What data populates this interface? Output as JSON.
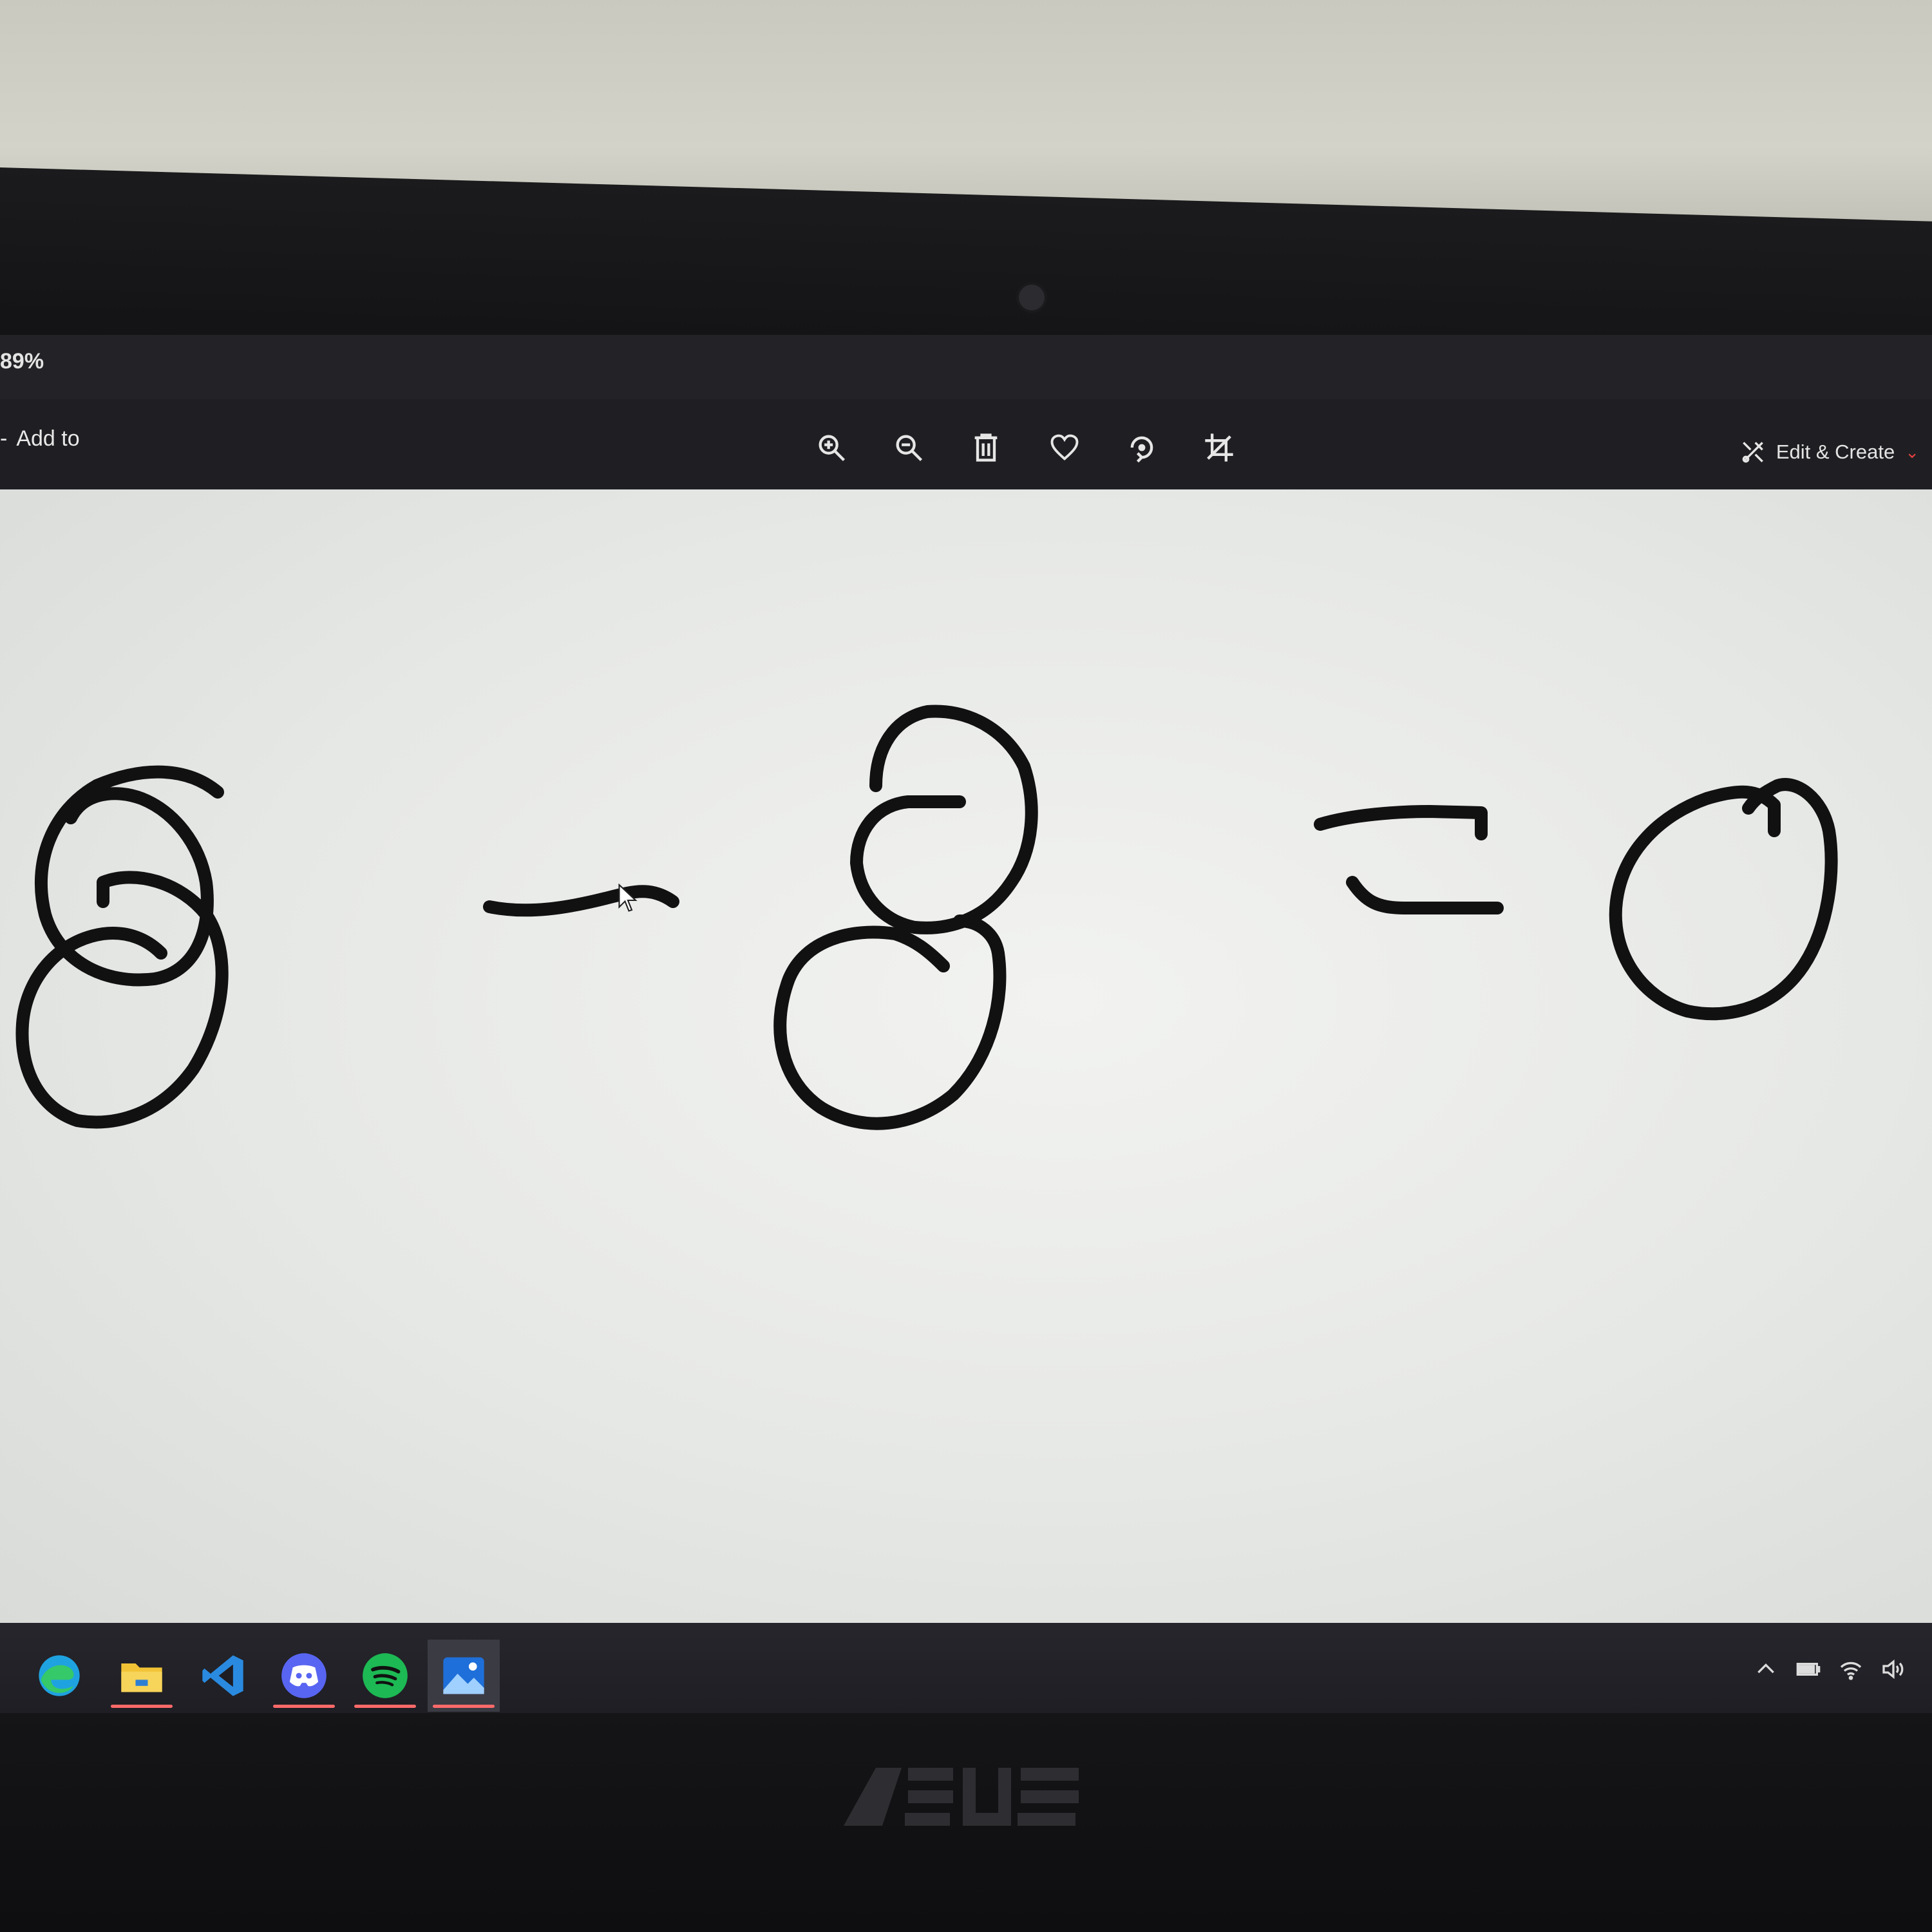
{
  "window": {
    "zoom_text": "89%"
  },
  "toolbar": {
    "add_to_label": "Add to",
    "tools": [
      {
        "name": "zoom-in-icon"
      },
      {
        "name": "zoom-out-icon"
      },
      {
        "name": "delete-icon"
      },
      {
        "name": "favorite-icon"
      },
      {
        "name": "rotate-icon"
      },
      {
        "name": "crop-icon"
      }
    ],
    "edit_create_label": "Edit & Create",
    "chevron": "⌄"
  },
  "canvas": {
    "background": "#eeefed",
    "ink_color": "#111111"
  },
  "taskbar": {
    "apps": [
      "edge-icon",
      "file-explorer-icon",
      "vscode-icon",
      "discord-icon",
      "spotify-icon",
      "photos-icon"
    ],
    "active_app": "photos-icon",
    "tray_icons": [
      "chevron-up-icon",
      "battery-icon",
      "wifi-icon",
      "volume-icon"
    ]
  },
  "bezel": {
    "logo_text": "/ISUS"
  },
  "colors": {
    "accent_red": "#e24040",
    "underline": "#ff6a6a"
  }
}
